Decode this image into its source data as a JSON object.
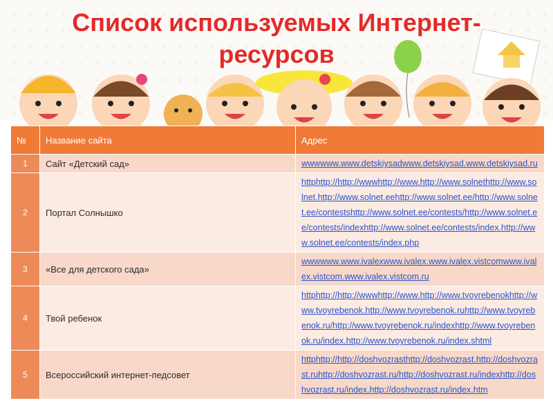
{
  "slide": {
    "title_line1": "Список используемых Интернет-",
    "title_line2": "ресурсов"
  },
  "table": {
    "headers": [
      "№",
      "Название сайта",
      "Адрес"
    ],
    "rows": [
      {
        "num": "1",
        "name": "Сайт «Детский сад»",
        "address": "wwwwww.www.detskiysadwww.detskiysad.www.detskiysad.ru"
      },
      {
        "num": "2",
        "name": "Портал Солнышко",
        "address": "httphttp://http://wwwhttp://www.http://www.solnethttp://www.solnet.http://www.solnet.eehttp://www.solnet.ee/http://www.solnet.ee/contestshttp://www.solnet.ee/contests/http://www.solnet.ee/contests/indexhttp://www.solnet.ee/contests/index.http://www.solnet.ee/contests/index.php"
      },
      {
        "num": "3",
        "name": "«Все для детского сада»",
        "address": "wwwwww.www.ivalexwww.ivalex.www.ivalex.vistcomwww.ivalex.vistcom.www.ivalex.vistcom.ru"
      },
      {
        "num": "4",
        "name": "Твой ребенок",
        "address": "httphttp://http://wwwhttp://www.http://www.tvoyrebenokhttp://www.tvoyrebenok.http://www.tvoyrebenok.ruhttp://www.tvoyrebenok.ru/http://www.tvoyrebenok.ru/indexhttp://www.tvoyrebenok.ru/index.http://www.tvoyrebenok.ru/index.shtml"
      },
      {
        "num": "5",
        "name": "Всероссийский интернет-педсовет",
        "address": "httphttp://http://doshvozrasthttp://doshvozrast.http://doshvozrast.ruhttp://doshvozrast.ru/http://doshvozrast.ru/indexhttp://doshvozrast.ru/index.http://doshvozrast.ru/index.htm"
      }
    ]
  }
}
